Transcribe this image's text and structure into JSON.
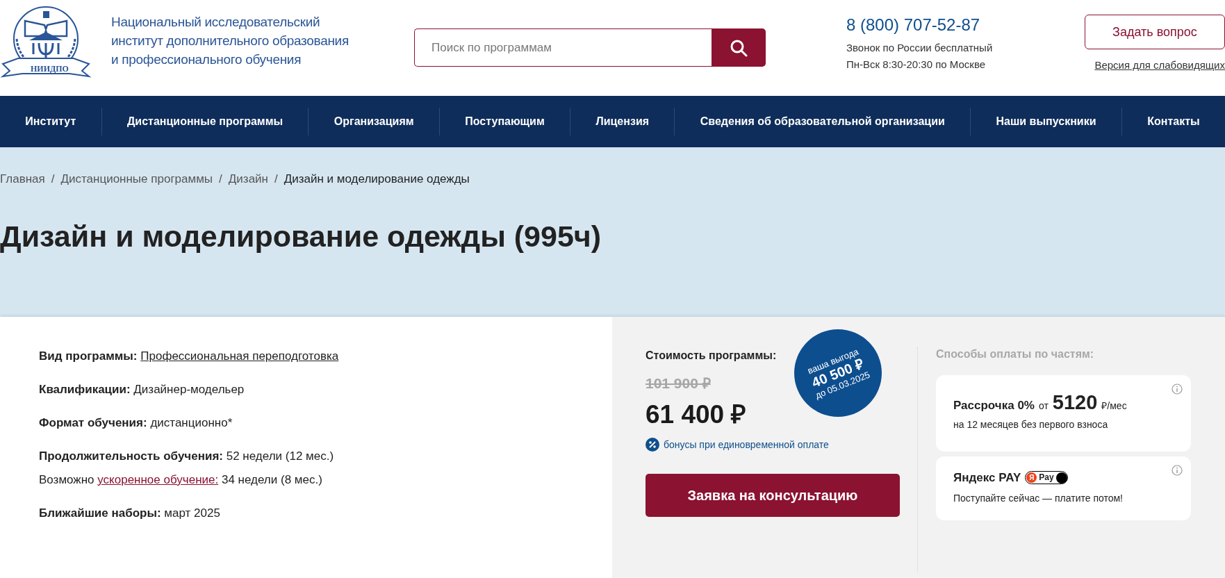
{
  "header": {
    "logo": {
      "abbr": "НИИДПО",
      "name_lines": [
        "Национальный исследовательский",
        "институт дополнительного образования",
        "и профессионального обучения"
      ]
    },
    "search": {
      "placeholder": "Поиск по программам"
    },
    "phone": "8 (800) 707-52-87",
    "phone_notes": [
      "Звонок по России бесплатный",
      "Пн-Вск 8:30-20:30 по Москве"
    ],
    "ask_button": "Задать вопрос",
    "accessibility_link": "Версия для слабовидящих"
  },
  "nav": {
    "items": [
      {
        "label": "Институт"
      },
      {
        "label": "Дистанционные программы"
      },
      {
        "label": "Организациям"
      },
      {
        "label": "Поступающим"
      },
      {
        "label": "Лицензия"
      },
      {
        "label": "Сведения об образовательной организации"
      },
      {
        "label": "Наши выпускники"
      },
      {
        "label": "Контакты"
      }
    ]
  },
  "breadcrumbs": [
    {
      "label": "Главная",
      "current": false,
      "separator": "/"
    },
    {
      "label": "Дистанционные программы",
      "current": false,
      "separator": "/"
    },
    {
      "label": "Дизайн",
      "current": false,
      "separator": "/"
    },
    {
      "label": "Дизайн и моделирование одежды",
      "current": true
    }
  ],
  "title": "Дизайн и моделирование одежды (995ч)",
  "details": [
    {
      "kind": "field",
      "label": "Вид программы:",
      "value": "Профессиональная переподготовка",
      "link": true
    },
    {
      "kind": "field",
      "label": "Квалификации:",
      "value": "Дизайнер-модельер",
      "link": false
    },
    {
      "kind": "field",
      "label": "Формат обучения:",
      "value": "дистанционно*",
      "link": false
    },
    {
      "kind": "field",
      "label": "Продолжительность обучения:",
      "value": "52 недели (12 мес.)",
      "link": false
    },
    {
      "kind": "note",
      "before": "Возможно",
      "link_text": "ускоренное обучение:",
      "after": "34 недели (8 мес.)"
    },
    {
      "kind": "field",
      "label": "Ближайшие наборы:",
      "value": "март 2025",
      "link": false
    }
  ],
  "price": {
    "title": "Стоимость программы:",
    "old_price": "101 900 ₽",
    "price": "61 400 ₽",
    "bonus": "бонусы при единовременной оплате",
    "badge": {
      "caption": "ваша выгода",
      "amount": "40 500 ₽",
      "until": "до 05.03.2025"
    },
    "button": "Заявка на консультацию"
  },
  "installments": {
    "title": "Способы оплаты по частям:",
    "cards": [
      {
        "kind": "installment",
        "title": "Рассрочка 0%",
        "from": "от",
        "amount": "5120",
        "unit": "₽/мес",
        "note": "на 12 месяцев без первого взноса"
      },
      {
        "kind": "yandex",
        "title": "Яндекс PAY",
        "badge_letter": "Я",
        "badge_text": "Pay",
        "note": "Поступайте сейчас — платите потом!"
      }
    ]
  }
}
